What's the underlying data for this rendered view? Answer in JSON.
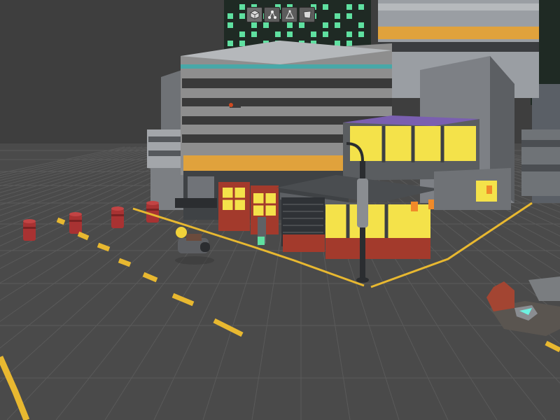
{
  "editor": {
    "view": "Scene view",
    "toolbar": {
      "tools": [
        {
          "name": "shaded-mode",
          "icon": "cube-icon",
          "active": true
        },
        {
          "name": "nodes-mode",
          "icon": "nodes-icon",
          "active": false
        },
        {
          "name": "vertex-mode",
          "icon": "vertex-triangle-icon",
          "active": false
        },
        {
          "name": "face-mode",
          "icon": "face-icon",
          "active": false
        }
      ]
    }
  },
  "scene": {
    "colors": {
      "ground": "#4a4a4a",
      "sky": "#3e3e3e",
      "grid_line": "#5a5a5a",
      "road_marking": "#e8b830",
      "window_glow": "#f4e24a",
      "building_gray": "#8e8e8e",
      "building_dark": "#3a3a3a",
      "orange_band": "#e0a23c",
      "teal_band": "#48a8a8",
      "barrel_red": "#a83232",
      "shop_red": "#a33a2c",
      "tower_window": "#5fe0a0"
    },
    "objects": [
      "office-building",
      "corner-shop",
      "street-lamp",
      "hover-bike",
      "barrels",
      "rubble-pile",
      "background-towers"
    ]
  }
}
